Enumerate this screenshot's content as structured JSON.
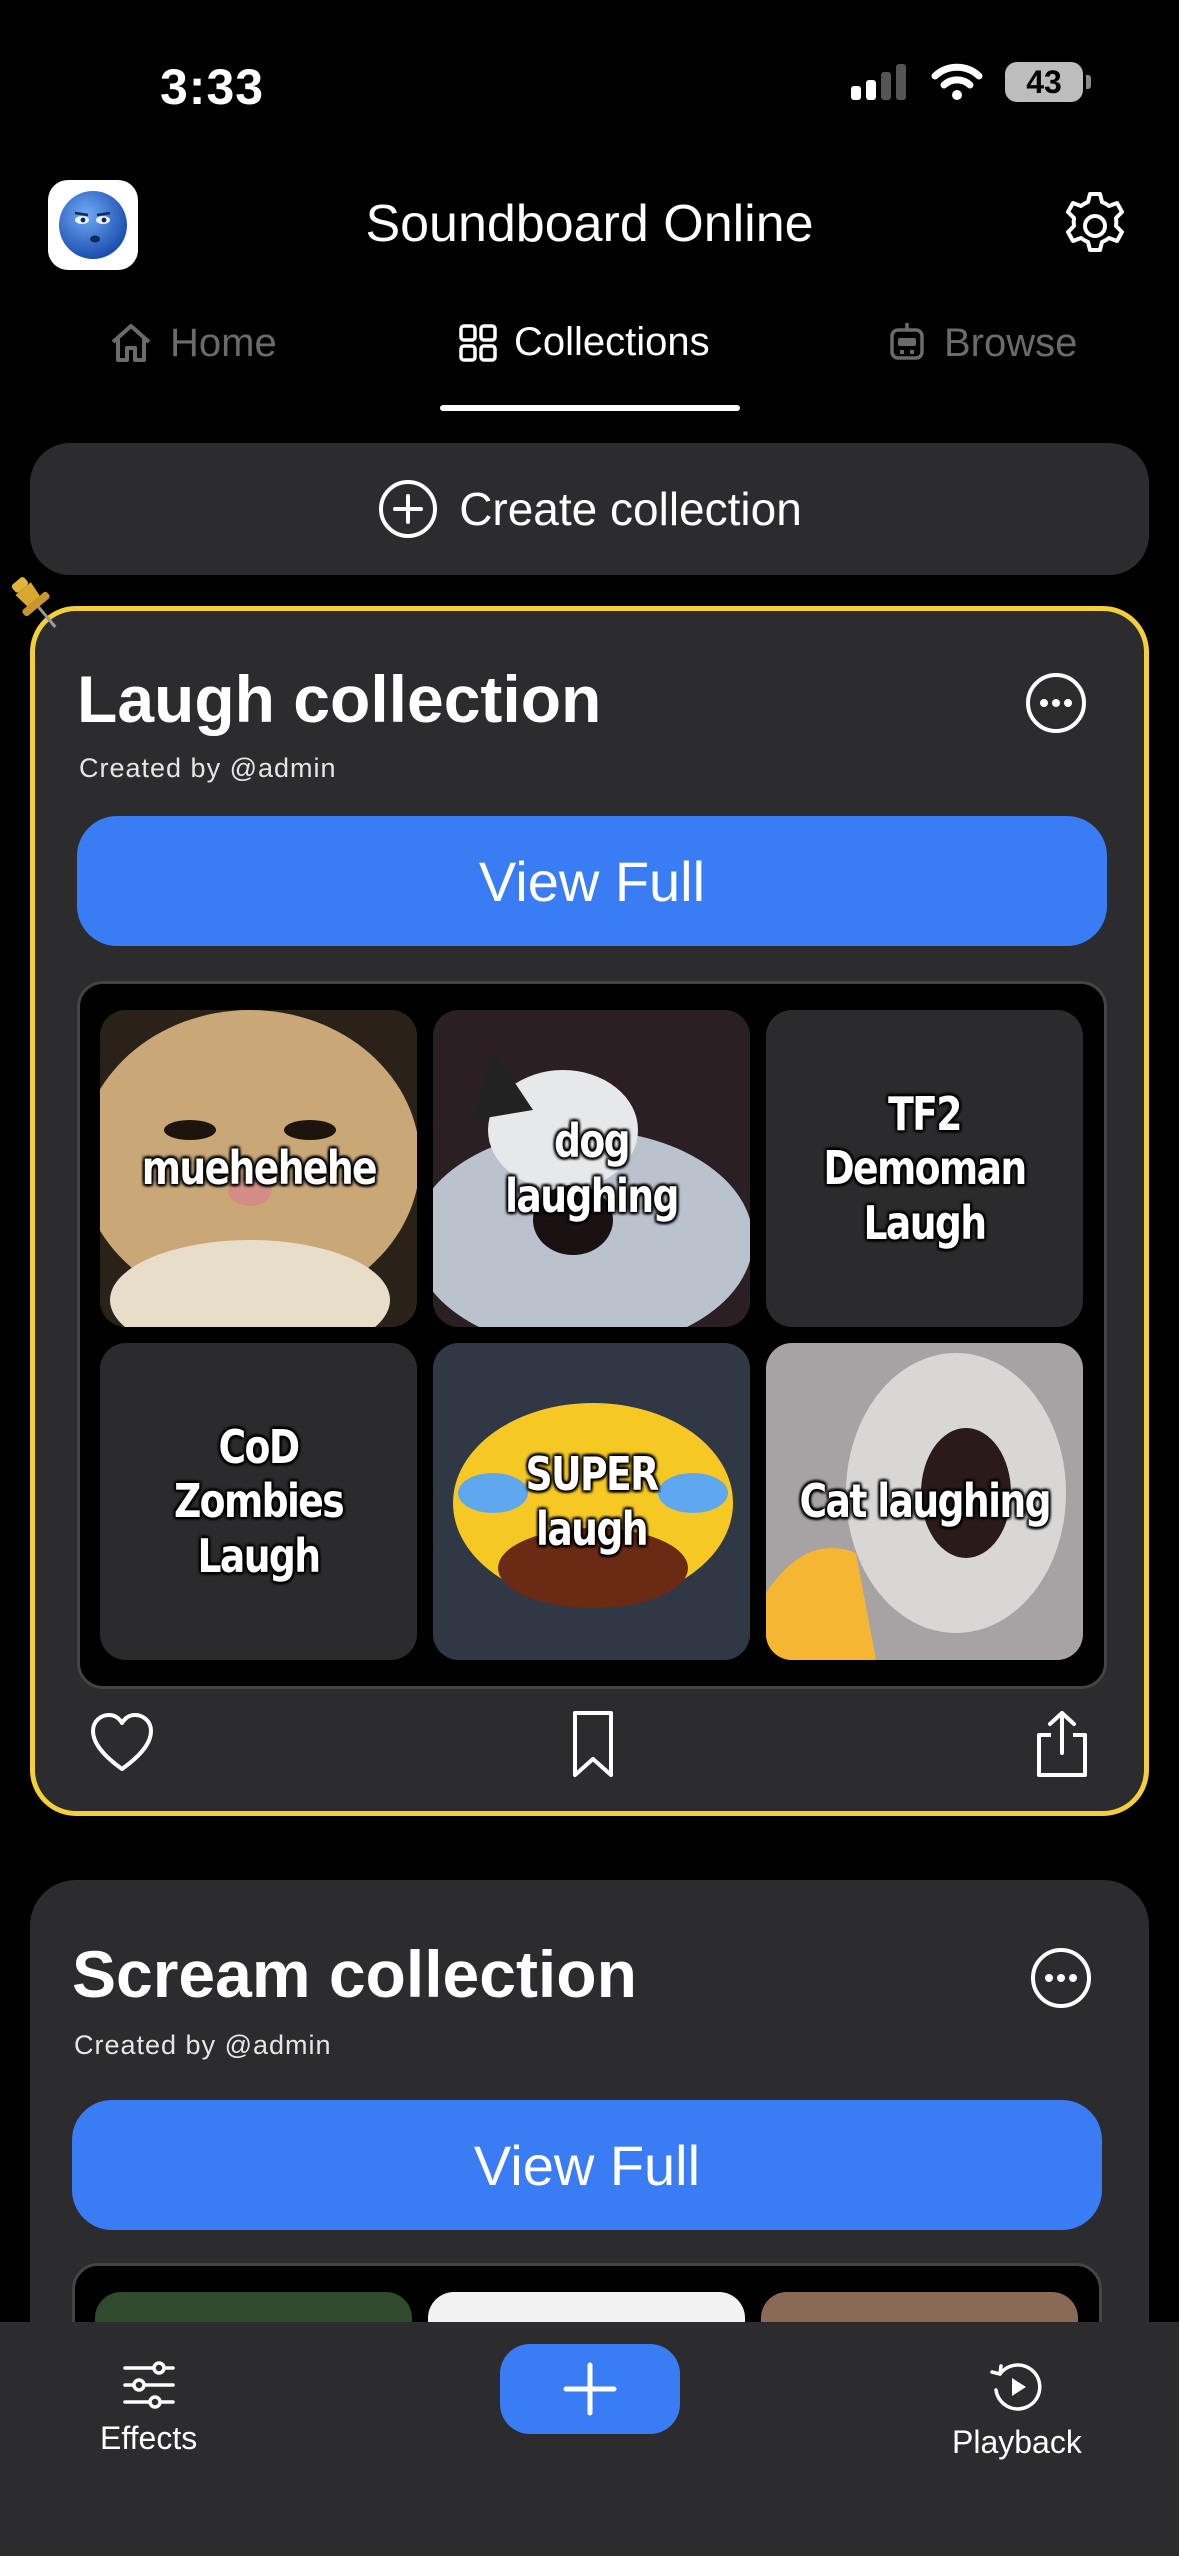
{
  "status": {
    "time": "3:33",
    "battery": "43"
  },
  "header": {
    "title": "Soundboard Online"
  },
  "tabs": [
    {
      "label": "Home",
      "icon": "home-icon",
      "active": false
    },
    {
      "label": "Collections",
      "icon": "grid-icon",
      "active": true
    },
    {
      "label": "Browse",
      "icon": "robot-icon",
      "active": false
    }
  ],
  "create_collection": {
    "label": "Create collection"
  },
  "collections": [
    {
      "title": "Laugh collection",
      "creator": "Created by @admin",
      "view_full": "View Full",
      "pinned": true,
      "sounds": [
        "muehehehe",
        "dog laughing",
        "TF2 Demoman Laugh",
        "CoD Zombies Laugh",
        "SUPER laugh",
        "Cat laughing"
      ]
    },
    {
      "title": "Scream collection",
      "creator": "Created by @admin",
      "view_full": "View Full",
      "pinned": false
    }
  ],
  "bottom_bar": {
    "effects": "Effects",
    "playback": "Playback"
  },
  "colors": {
    "accent": "#3a7cf4",
    "pin_border": "#f4cf3c",
    "card_bg": "#2c2c2e"
  }
}
